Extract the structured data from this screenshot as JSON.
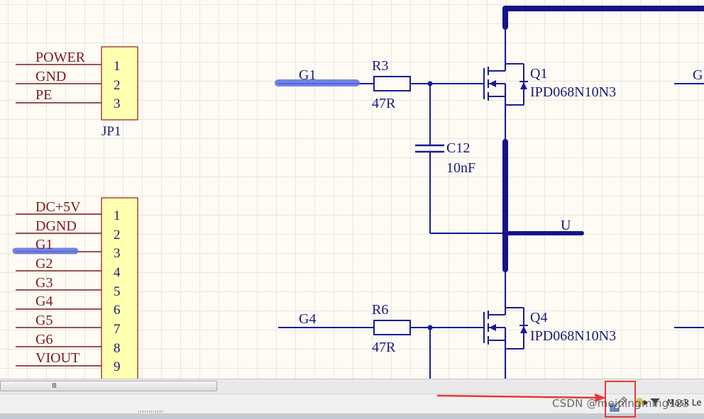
{
  "connectors": {
    "jp1": {
      "pins": [
        "1",
        "2",
        "3"
      ],
      "nets": [
        "POWER",
        "GND",
        "PE"
      ],
      "designator": "JP1"
    },
    "jp2": {
      "pins": [
        "1",
        "2",
        "3",
        "4",
        "5",
        "6",
        "7",
        "8",
        "9"
      ],
      "nets": [
        "DC+5V",
        "DGND",
        "G1",
        "G2",
        "G3",
        "G4",
        "G5",
        "G6",
        "VIOUT"
      ]
    }
  },
  "components": {
    "r3": {
      "designator": "R3",
      "value": "47R"
    },
    "r6": {
      "designator": "R6",
      "value": "47R"
    },
    "c12": {
      "designator": "C12",
      "value": "10nF"
    },
    "q1": {
      "designator": "Q1",
      "part": "IPD068N10N3"
    },
    "q4": {
      "designator": "Q4",
      "part": "IPD068N10N3"
    }
  },
  "net_labels": {
    "g1": "G1",
    "g4": "G4",
    "u": "U",
    "g_partial": "G"
  },
  "scrollbar": {
    "grip": "III"
  },
  "statusbar": {
    "mask_label": "Mask Le",
    "icons": [
      "pencil-icon",
      "bulb-icon",
      "filter-icon"
    ]
  },
  "watermark": "CSDN @meiningming123",
  "colors": {
    "wire": "#1a1a9a",
    "bus": "#14148a",
    "pin": "#7a1a1a",
    "body_fill": "#ffffb0",
    "body_stroke": "#8a1a1a",
    "highlight": "#5d6fe0",
    "annotation": "#e53935"
  }
}
